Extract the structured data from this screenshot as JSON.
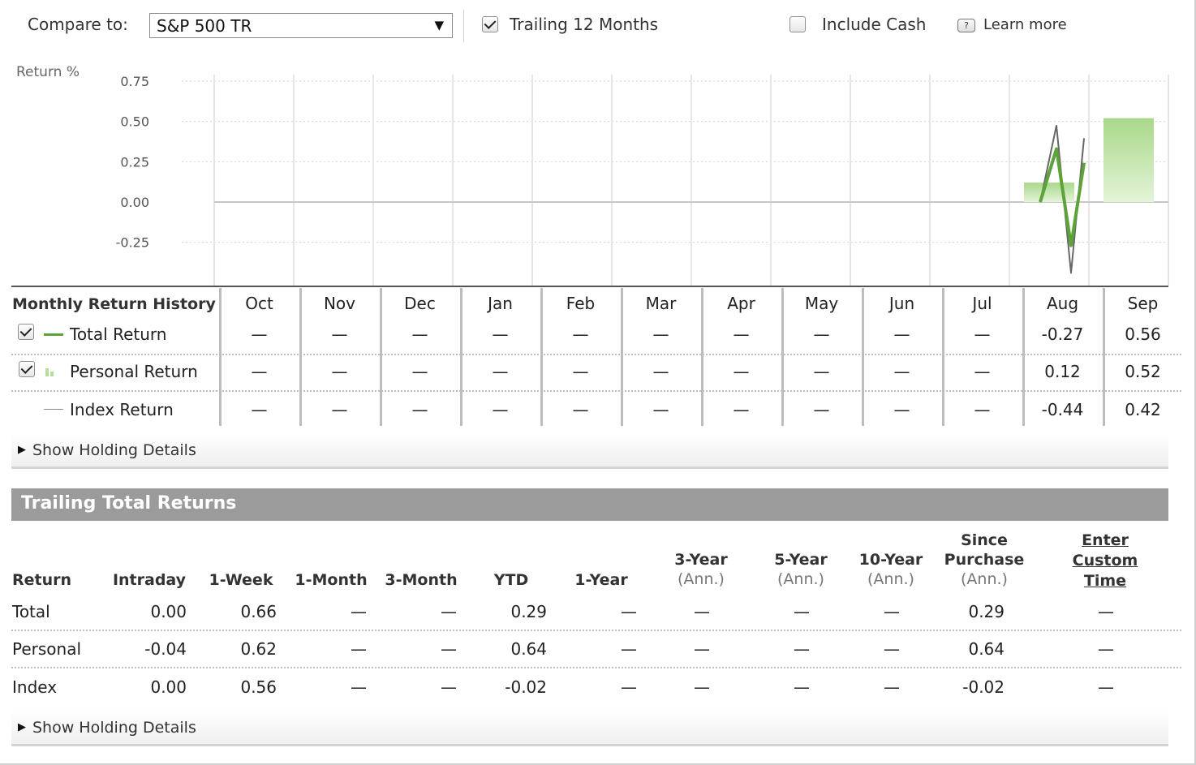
{
  "toolbar": {
    "compare_label": "Compare to:",
    "compare_value": "S&P 500 TR",
    "dropdown_arrow": "▼",
    "trailing_label": "Trailing 12 Months",
    "trailing_checked": true,
    "cash_label": "Include Cash",
    "cash_checked": false,
    "help_icon": "?",
    "learn_more": "Learn more"
  },
  "chart_data": {
    "type": "bar",
    "ylabel": "Return %",
    "yticks": [
      "0.75",
      "0.50",
      "0.25",
      "0.00",
      "-0.25"
    ],
    "ylim": [
      -0.35,
      0.75
    ],
    "categories": [
      "Oct",
      "Nov",
      "Dec",
      "Jan",
      "Feb",
      "Mar",
      "Apr",
      "May",
      "Jun",
      "Jul",
      "Aug",
      "Sep"
    ],
    "series": [
      {
        "name": "Personal Return",
        "kind": "bar",
        "color": "#b5de97",
        "values": [
          null,
          null,
          null,
          null,
          null,
          null,
          null,
          null,
          null,
          null,
          0.12,
          0.52
        ]
      },
      {
        "name": "Total Return",
        "kind": "line",
        "color": "#5ea33a",
        "values": [
          null,
          null,
          null,
          null,
          null,
          null,
          null,
          null,
          null,
          null,
          -0.27,
          0.56
        ]
      },
      {
        "name": "Index Return",
        "kind": "line",
        "color": "#666666",
        "values": [
          null,
          null,
          null,
          null,
          null,
          null,
          null,
          null,
          null,
          null,
          -0.44,
          0.42
        ]
      }
    ],
    "grid": true
  },
  "monthly": {
    "title": "Monthly Return History",
    "months": [
      "Oct",
      "Nov",
      "Dec",
      "Jan",
      "Feb",
      "Mar",
      "Apr",
      "May",
      "Jun",
      "Jul",
      "Aug",
      "Sep"
    ],
    "rows": [
      {
        "label": "Total Return",
        "checked": true,
        "values": [
          "—",
          "—",
          "—",
          "—",
          "—",
          "—",
          "—",
          "—",
          "—",
          "—",
          "-0.27",
          "0.56"
        ]
      },
      {
        "label": "Personal Return",
        "checked": true,
        "values": [
          "—",
          "—",
          "—",
          "—",
          "—",
          "—",
          "—",
          "—",
          "—",
          "—",
          "0.12",
          "0.52"
        ]
      },
      {
        "label": "Index Return",
        "checked": false,
        "values": [
          "—",
          "—",
          "—",
          "—",
          "—",
          "—",
          "—",
          "—",
          "—",
          "—",
          "-0.44",
          "0.42"
        ]
      }
    ],
    "details_label": "Show Holding Details"
  },
  "trailing": {
    "title": "Trailing Total Returns",
    "headers": [
      {
        "label": "Return",
        "sub": ""
      },
      {
        "label": "Intraday",
        "sub": ""
      },
      {
        "label": "1-Week",
        "sub": ""
      },
      {
        "label": "1-Month",
        "sub": ""
      },
      {
        "label": "3-Month",
        "sub": ""
      },
      {
        "label": "YTD",
        "sub": ""
      },
      {
        "label": "1-Year",
        "sub": ""
      },
      {
        "label": "3-Year",
        "sub": "(Ann.)"
      },
      {
        "label": "5-Year",
        "sub": "(Ann.)"
      },
      {
        "label": "10-Year",
        "sub": "(Ann.)"
      },
      {
        "label": "Since Purchase",
        "sub": "(Ann.)"
      },
      {
        "label": "Enter Custom Time",
        "sub": ""
      }
    ],
    "rows": [
      {
        "label": "Total",
        "values": [
          "0.00",
          "0.66",
          "—",
          "—",
          "0.29",
          "—",
          "—",
          "—",
          "—",
          "0.29",
          "—"
        ]
      },
      {
        "label": "Personal",
        "values": [
          "-0.04",
          "0.62",
          "—",
          "—",
          "0.64",
          "—",
          "—",
          "—",
          "—",
          "0.64",
          "—"
        ]
      },
      {
        "label": "Index",
        "values": [
          "0.00",
          "0.56",
          "—",
          "—",
          "-0.02",
          "—",
          "—",
          "—",
          "—",
          "-0.02",
          "—"
        ]
      }
    ],
    "details_label": "Show Holding Details"
  },
  "colors": {
    "total": "#5ea33a",
    "personal": "#b5de97",
    "index": "#666666",
    "header_bar": "#9b9b9b"
  }
}
